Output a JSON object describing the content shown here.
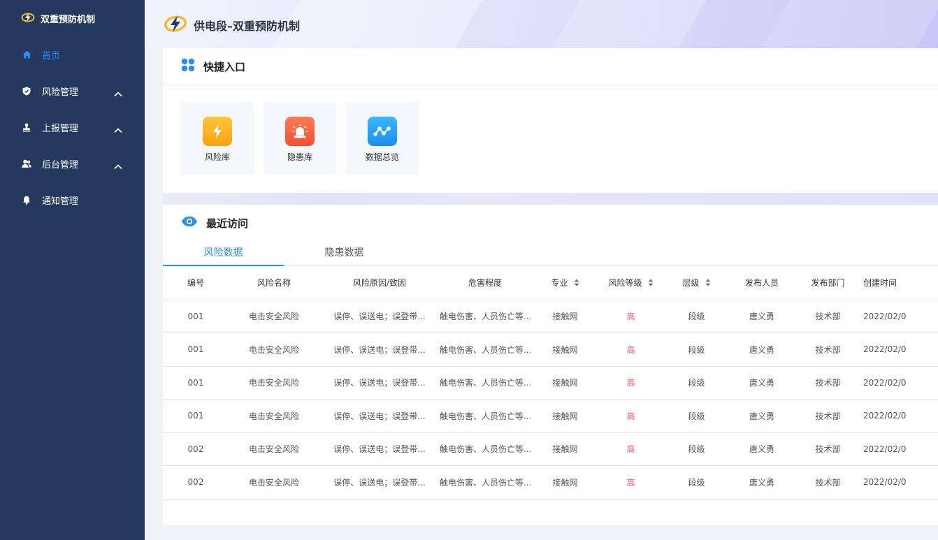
{
  "sidebar": {
    "brand": "双重预防机制",
    "items": [
      {
        "label": "首页"
      },
      {
        "label": "风险管理"
      },
      {
        "label": "上报管理"
      },
      {
        "label": "后台管理"
      },
      {
        "label": "通知管理"
      }
    ]
  },
  "header": {
    "title": "供电段–双重预防机制"
  },
  "quick": {
    "title": "快捷入口",
    "tiles": [
      {
        "label": "风险库"
      },
      {
        "label": "隐患库"
      },
      {
        "label": "数据总览"
      }
    ]
  },
  "recent": {
    "title": "最近访问",
    "tabs": [
      {
        "label": "风险数据"
      },
      {
        "label": "隐患数据"
      }
    ],
    "columns": [
      "编号",
      "风险名称",
      "风险原因/致因",
      "危害程度",
      "专业",
      "风险等级",
      "层级",
      "发布人员",
      "发布部门",
      "创建时间"
    ],
    "rows": [
      {
        "id": "001",
        "name": "电击安全风险",
        "cause": "误停、误送电；误登带...",
        "harm": "触电伤害、人员伤亡等...",
        "major": "接触网",
        "level": "高",
        "tier": "段级",
        "publisher": "唐义勇",
        "dept": "技术部",
        "date": "2022/02/0"
      },
      {
        "id": "001",
        "name": "电击安全风险",
        "cause": "误停、误送电；误登带...",
        "harm": "触电伤害、人员伤亡等...",
        "major": "接触网",
        "level": "高",
        "tier": "段级",
        "publisher": "唐义勇",
        "dept": "技术部",
        "date": "2022/02/0"
      },
      {
        "id": "001",
        "name": "电击安全风险",
        "cause": "误停、误送电；误登带...",
        "harm": "触电伤害、人员伤亡等...",
        "major": "接触网",
        "level": "高",
        "tier": "段级",
        "publisher": "唐义勇",
        "dept": "技术部",
        "date": "2022/02/0"
      },
      {
        "id": "001",
        "name": "电击安全风险",
        "cause": "误停、误送电；误登带...",
        "harm": "触电伤害、人员伤亡等...",
        "major": "接触网",
        "level": "高",
        "tier": "段级",
        "publisher": "唐义勇",
        "dept": "技术部",
        "date": "2022/02/0"
      },
      {
        "id": "002",
        "name": "电击安全风险",
        "cause": "误停、误送电；误登带...",
        "harm": "触电伤害、人员伤亡等...",
        "major": "接触网",
        "level": "高",
        "tier": "段级",
        "publisher": "唐义勇",
        "dept": "技术部",
        "date": "2022/02/0"
      },
      {
        "id": "002",
        "name": "电击安全风险",
        "cause": "误停、误送电；误登带...",
        "harm": "触电伤害、人员伤亡等...",
        "major": "接触网",
        "level": "高",
        "tier": "段级",
        "publisher": "唐义勇",
        "dept": "技术部",
        "date": "2022/02/0"
      }
    ]
  },
  "colors": {
    "sidebar_bg": "#233a5e",
    "accent": "#2d8cf0",
    "risk_high": "#f35b5b"
  },
  "icons": {
    "brand": "lightning-logo-icon",
    "home": "home-icon",
    "risk": "shield-icon",
    "report": "stamp-icon",
    "admin": "users-icon",
    "notify": "bell-icon",
    "quick": "grid-dots-icon",
    "recent": "eye-icon"
  }
}
